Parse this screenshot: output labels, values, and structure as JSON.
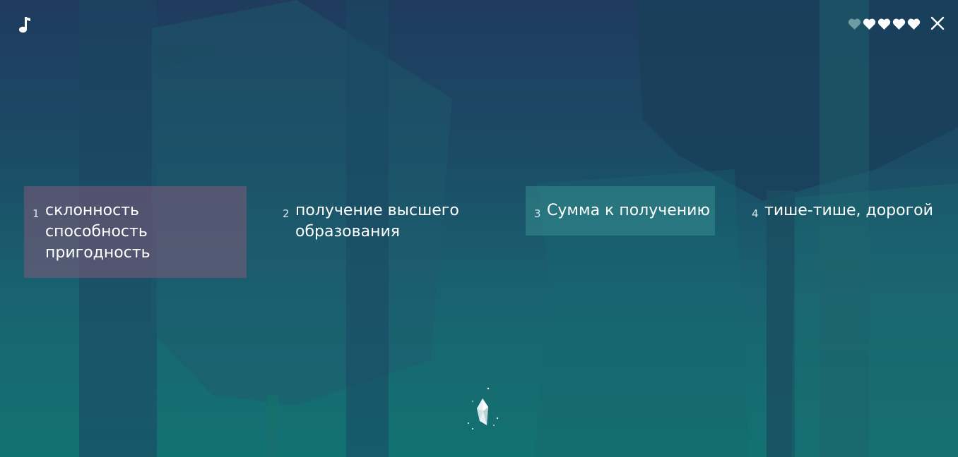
{
  "icons": {
    "music": "music-note-icon",
    "close": "close-icon",
    "heart": "heart-icon",
    "crystal": "crystal-icon"
  },
  "lives": {
    "total": 5,
    "filled": 4
  },
  "options": [
    {
      "number": "1",
      "text": "склонность\nспособность\nпригодность",
      "state": "wrong"
    },
    {
      "number": "2",
      "text": "получение высшего\nобразования",
      "state": "default"
    },
    {
      "number": "3",
      "text": "Сумма к получению",
      "state": "hover"
    },
    {
      "number": "4",
      "text": "тише-тише, дорогой",
      "state": "default"
    }
  ],
  "colors": {
    "wrong_highlight": "#825a78",
    "hover_highlight": "#3c9696",
    "heart_filled": "#ffffff",
    "heart_empty": "#6f9aa3"
  }
}
